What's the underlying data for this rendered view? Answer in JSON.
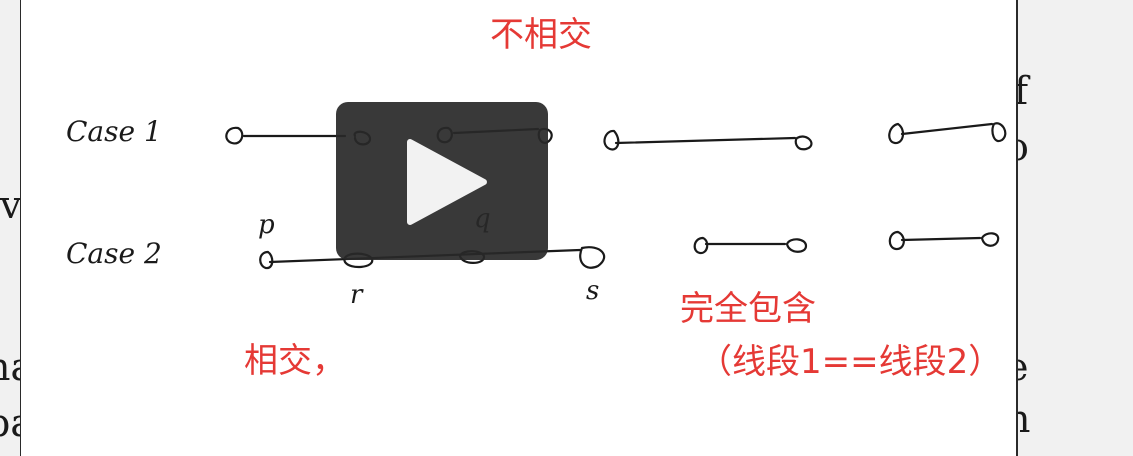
{
  "page": {
    "left_edge_text": [
      "v",
      "ha",
      "pa"
    ],
    "right_edge_text": [
      "f",
      "o",
      "e",
      "n"
    ]
  },
  "annotations": {
    "no_intersect": "不相交",
    "intersect": "相交，",
    "full_contain": "完全包含",
    "equal_note": "（线段1==线段2）"
  },
  "sketch": {
    "case1_label": "Case 1",
    "case2_label": "Case 2",
    "p_label": "p",
    "q_label": "q",
    "r_label": "r",
    "s_label": "s"
  },
  "video": {
    "play_icon": "play-icon"
  },
  "colors": {
    "annotation_red": "#e53935",
    "ink": "#1a1a1a",
    "overlay": "#2a2a2a"
  }
}
